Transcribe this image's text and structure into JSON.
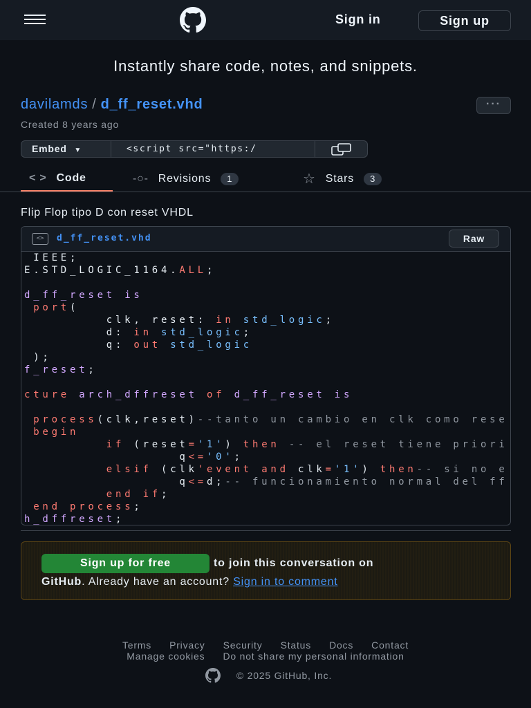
{
  "header": {
    "sign_in": "Sign in",
    "sign_up": "Sign up"
  },
  "tagline": "Instantly share code, notes, and snippets.",
  "gist": {
    "owner": "davilamds",
    "separator": "/",
    "filename": "d_ff_reset.vhd",
    "more": "···",
    "created": "Created 8 years ago",
    "description": "Flip Flop tipo D con reset VHDL"
  },
  "embed": {
    "label": "Embed",
    "value": "<script src=\"https:/"
  },
  "tabs": [
    {
      "label": "Code",
      "icon": "code-icon"
    },
    {
      "label": "Revisions",
      "count": "1",
      "icon": "commit-icon"
    },
    {
      "label": "Stars",
      "count": "3",
      "icon": "star-icon"
    }
  ],
  "file": {
    "name": "d_ff_reset.vhd",
    "raw": "Raw"
  },
  "code_lines": [
    [
      [
        " IEEE;",
        "t"
      ]
    ],
    [
      [
        "E.STD_LOGIC_1164.",
        "t"
      ],
      [
        "ALL",
        "k"
      ],
      [
        ";",
        "t"
      ]
    ],
    [],
    [
      [
        "d_ff_reset ",
        "p"
      ],
      [
        "is",
        "p"
      ]
    ],
    [
      [
        " ",
        "t"
      ],
      [
        "port",
        "k"
      ],
      [
        "(",
        "t"
      ]
    ],
    [
      [
        "         clk, reset: ",
        "t"
      ],
      [
        "in",
        "k"
      ],
      [
        " ",
        "t"
      ],
      [
        "std_logic",
        "b"
      ],
      [
        ";",
        "t"
      ]
    ],
    [
      [
        "         d: ",
        "t"
      ],
      [
        "in",
        "k"
      ],
      [
        " ",
        "t"
      ],
      [
        "std_logic",
        "b"
      ],
      [
        ";",
        "t"
      ]
    ],
    [
      [
        "         q: ",
        "t"
      ],
      [
        "out",
        "k"
      ],
      [
        " ",
        "t"
      ],
      [
        "std_logic",
        "b"
      ]
    ],
    [
      [
        " );",
        "t"
      ]
    ],
    [
      [
        "f_reset",
        "p"
      ],
      [
        ";",
        "t"
      ]
    ],
    [],
    [
      [
        "cture ",
        "k"
      ],
      [
        "arch_dffreset ",
        "p"
      ],
      [
        "of ",
        "k"
      ],
      [
        "d_ff_reset ",
        "p"
      ],
      [
        "is",
        "p"
      ]
    ],
    [],
    [
      [
        " ",
        "t"
      ],
      [
        "process",
        "k"
      ],
      [
        "(clk,reset)",
        "t"
      ],
      [
        "--tanto un cambio en clk como rese",
        "c"
      ]
    ],
    [
      [
        " ",
        "t"
      ],
      [
        "begin",
        "k"
      ]
    ],
    [
      [
        "         ",
        "t"
      ],
      [
        "if",
        "k"
      ],
      [
        " (reset",
        "t"
      ],
      [
        "=",
        "k"
      ],
      [
        "'1'",
        "b"
      ],
      [
        ") ",
        "t"
      ],
      [
        "then",
        "k"
      ],
      [
        " -- el reset tiene priori",
        "c"
      ]
    ],
    [
      [
        "                 q",
        "t"
      ],
      [
        "<=",
        "k"
      ],
      [
        "'0'",
        "b"
      ],
      [
        ";",
        "t"
      ]
    ],
    [
      [
        "         ",
        "t"
      ],
      [
        "elsif",
        "k"
      ],
      [
        " (clk",
        "t"
      ],
      [
        "'event",
        "k"
      ],
      [
        " ",
        "t"
      ],
      [
        "and",
        "k"
      ],
      [
        " clk",
        "t"
      ],
      [
        "=",
        "k"
      ],
      [
        "'1'",
        "b"
      ],
      [
        ") ",
        "t"
      ],
      [
        "then",
        "k"
      ],
      [
        "-- si no e",
        "c"
      ]
    ],
    [
      [
        "                 q",
        "t"
      ],
      [
        "<=",
        "k"
      ],
      [
        "d;",
        "t"
      ],
      [
        "-- funcionamiento normal del ff",
        "c"
      ]
    ],
    [
      [
        "         ",
        "t"
      ],
      [
        "end",
        "k"
      ],
      [
        " ",
        "t"
      ],
      [
        "if",
        "k"
      ],
      [
        ";",
        "t"
      ]
    ],
    [
      [
        " ",
        "t"
      ],
      [
        "end",
        "k"
      ],
      [
        " ",
        "t"
      ],
      [
        "process",
        "k"
      ],
      [
        ";",
        "t"
      ]
    ],
    [
      [
        "h_dffreset",
        "p"
      ],
      [
        ";",
        "t"
      ]
    ]
  ],
  "join": {
    "button": "Sign up for free",
    "text1": "to join this conversation on",
    "github": "GitHub",
    "text2": ". Already have an account?",
    "link": "Sign in to comment"
  },
  "footer": {
    "links": [
      "Terms",
      "Privacy",
      "Security",
      "Status",
      "Docs",
      "Contact"
    ],
    "links2": [
      "Manage cookies",
      "Do not share my personal information"
    ],
    "copyright": "© 2025 GitHub, Inc."
  }
}
